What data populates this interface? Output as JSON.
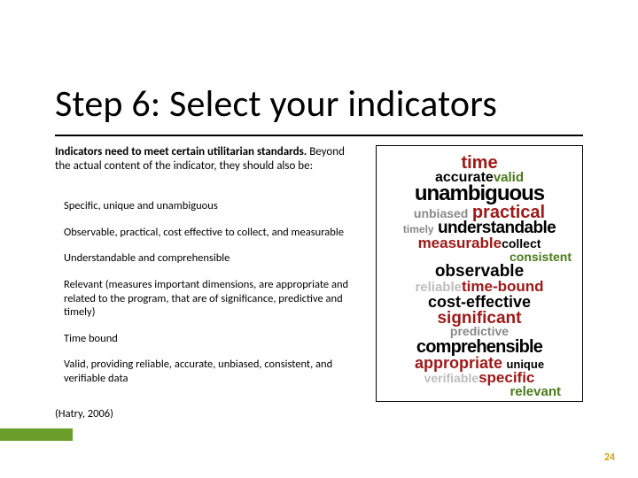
{
  "title": "Step 6: Select your indicators",
  "intro_bold": "Indicators need to meet certain utilitarian standards.",
  "intro_rest": " Beyond the actual content of the indicator, they should also be:",
  "bullets": [
    "Specific, unique and unambiguous",
    "Observable, practical, cost effective to collect, and measurable",
    "Understandable and comprehensible",
    "Relevant (measures important dimensions, are appropriate and related to the program, that are of significance, predictive and timely)",
    "Time bound",
    "Valid, providing reliable, accurate, unbiased, consistent, and verifiable data"
  ],
  "citation": "(Hatry, 2006)",
  "page_number": "24",
  "wordcloud": {
    "time": "time",
    "accurate": "accurate",
    "valid": "valid",
    "unambiguous": "unambiguous",
    "unbiased": "unbiased",
    "practical": "practical",
    "timely": "timely",
    "understandable": "understandable",
    "measurable": "measurable",
    "collect": "collect",
    "consistent": "consistent",
    "observable": "observable",
    "reliable": "reliable",
    "time_bound": "time-bound",
    "cost_effective": "cost-effective",
    "significant": "significant",
    "predictive": "predictive",
    "comprehensible": "comprehensible",
    "appropriate": "appropriate",
    "unique": "unique",
    "verifiable": "verifiable",
    "specific": "specific",
    "relevant": "relevant"
  }
}
